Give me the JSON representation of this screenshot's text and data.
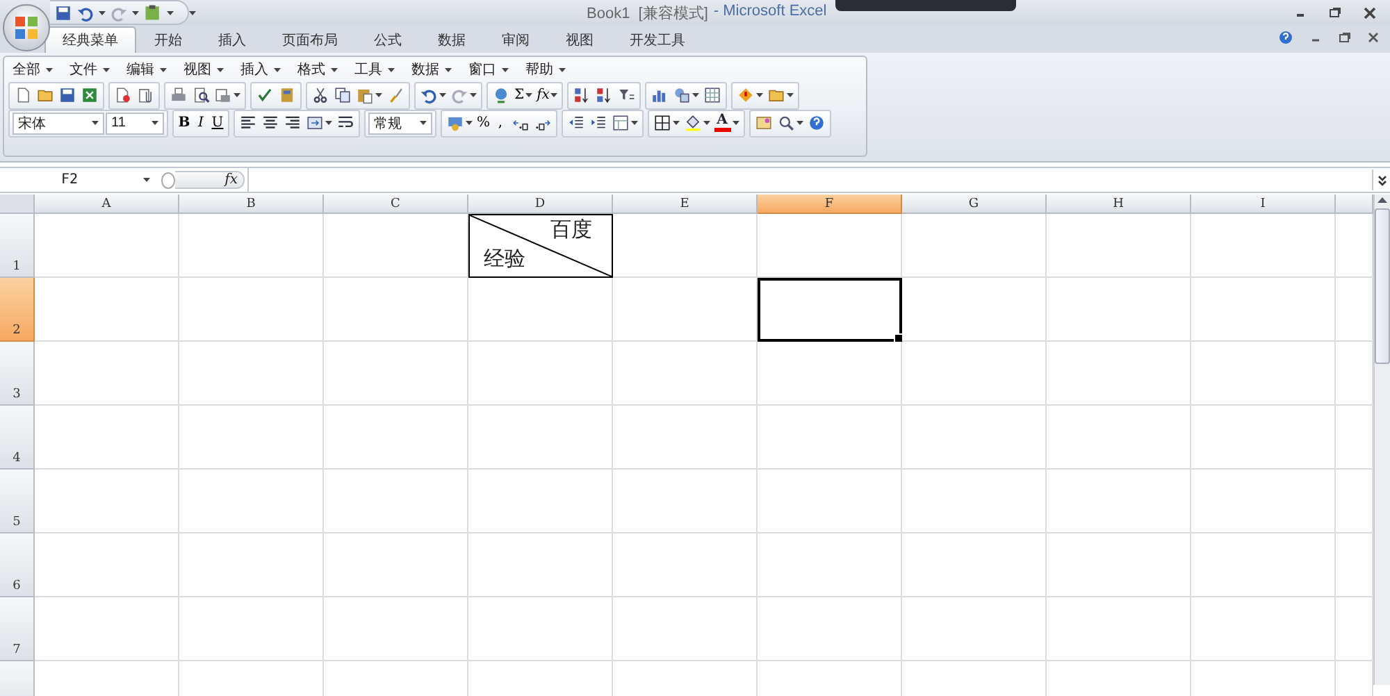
{
  "title_bar": {
    "document": "Book1  [兼容模式]",
    "app": "- Microsoft Excel"
  },
  "tabs": [
    {
      "label": "经典菜单",
      "selected": true
    },
    {
      "label": "开始",
      "selected": false
    },
    {
      "label": "插入",
      "selected": false
    },
    {
      "label": "页面布局",
      "selected": false
    },
    {
      "label": "公式",
      "selected": false
    },
    {
      "label": "数据",
      "selected": false
    },
    {
      "label": "审阅",
      "selected": false
    },
    {
      "label": "视图",
      "selected": false
    },
    {
      "label": "开发工具",
      "selected": false
    }
  ],
  "menus": [
    "全部",
    "文件",
    "编辑",
    "视图",
    "插入",
    "格式",
    "工具",
    "数据",
    "窗口",
    "帮助"
  ],
  "toolbar": {
    "sum": "Σ",
    "function": "fx",
    "font": "宋体",
    "font_size": "11",
    "bold": "B",
    "italic": "I",
    "underline": "U",
    "number_format": "常规",
    "percent": "%",
    "comma": ",",
    "font_color": "A"
  },
  "formula_bar": {
    "name_box": "F2",
    "function_label": "fx"
  },
  "grid": {
    "columns": [
      {
        "label": "A",
        "selected": false
      },
      {
        "label": "B",
        "selected": false
      },
      {
        "label": "C",
        "selected": false
      },
      {
        "label": "D",
        "selected": false
      },
      {
        "label": "E",
        "selected": false
      },
      {
        "label": "F",
        "selected": true
      },
      {
        "label": "G",
        "selected": false
      },
      {
        "label": "H",
        "selected": false
      },
      {
        "label": "I",
        "selected": false
      }
    ],
    "rows": [
      {
        "label": "1",
        "selected": false,
        "cells": [
          {
            "kind": "blank"
          },
          {
            "kind": "blank"
          },
          {
            "kind": "blank"
          },
          {
            "kind": "diagonal",
            "top_right": "百度",
            "bottom_left": "经验"
          },
          {
            "kind": "blank"
          },
          {
            "kind": "blank"
          },
          {
            "kind": "blank"
          },
          {
            "kind": "blank"
          },
          {
            "kind": "blank"
          }
        ]
      },
      {
        "label": "2",
        "selected": true
      },
      {
        "label": "3",
        "selected": false
      },
      {
        "label": "4",
        "selected": false
      },
      {
        "label": "5",
        "selected": false
      },
      {
        "label": "6",
        "selected": false
      },
      {
        "label": "7",
        "selected": false
      }
    ]
  }
}
